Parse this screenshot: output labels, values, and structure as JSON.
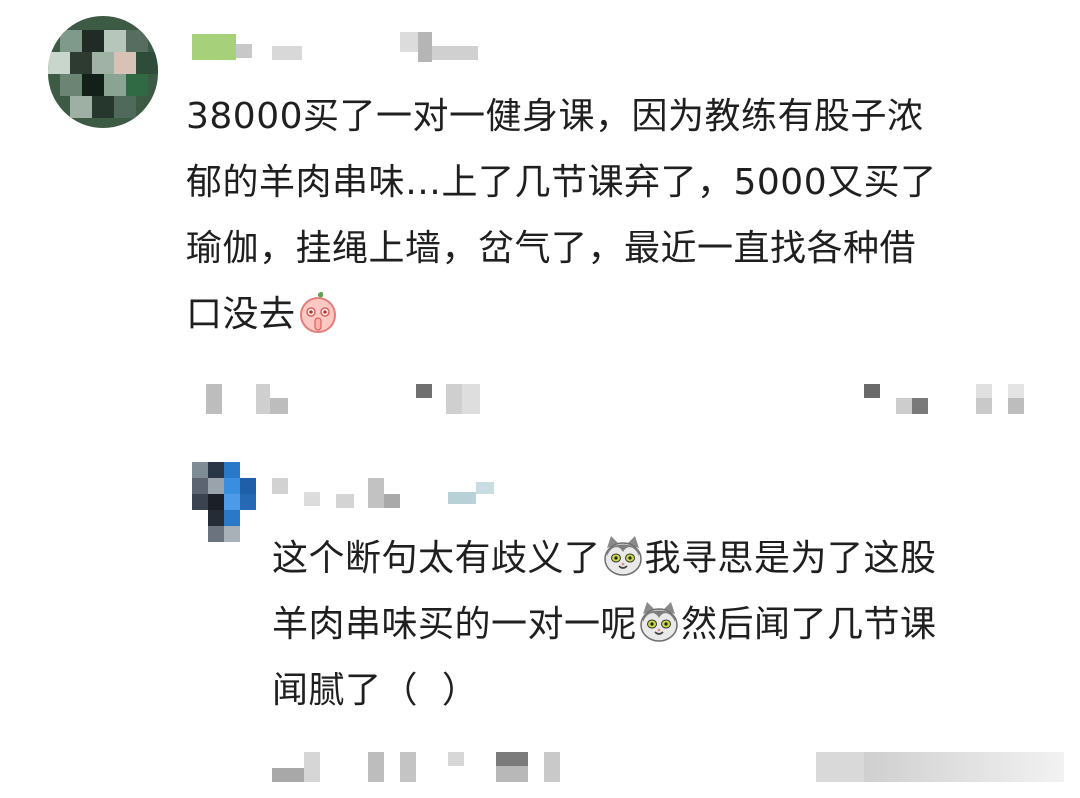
{
  "comment": {
    "lines": [
      "38000买了一对一健身课，因为教练有股子浓",
      "郁的羊肉串味…上了几节课弃了，5000又买了",
      "瑜伽，挂绳上墙，岔气了，最近一直找各种借",
      "口没去"
    ],
    "emoji_name": "peach-shush-emoji-icon"
  },
  "reply": {
    "lines": [
      "这个断句太有歧义了",
      "我寻思是为了这股",
      "羊肉串味买的一对一呢",
      "然后闻了几节课",
      "闻腻了（  ）"
    ],
    "emoji_name": "cat-face-emoji-icon"
  },
  "colors": {
    "text": "#1f1f1f",
    "background": "#ffffff",
    "blur_gray": "#b9b9b9",
    "blur_dark": "#5a5a5a",
    "blur_green": "#a7d07a",
    "blur_blue": "#2a78c8"
  }
}
